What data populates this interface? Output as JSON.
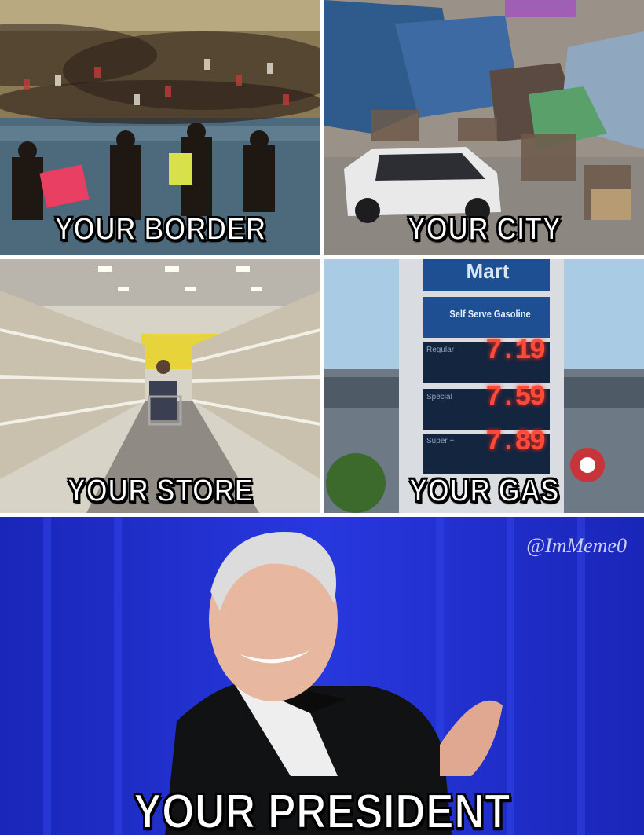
{
  "panels": [
    {
      "id": "border",
      "caption": "YOUR BORDER"
    },
    {
      "id": "city",
      "caption": "YOUR CITY"
    },
    {
      "id": "store",
      "caption": "YOUR STORE"
    },
    {
      "id": "gas",
      "caption": "YOUR GAS"
    },
    {
      "id": "president",
      "caption": "YOUR PRESIDENT"
    }
  ],
  "gas_sign": {
    "brand": "Mart",
    "header": "Self Serve Gasoline",
    "grades": [
      {
        "label": "Regular",
        "price": "7.19"
      },
      {
        "label": "Special",
        "price": "7.59"
      },
      {
        "label": "Super +",
        "price": "7.89"
      }
    ]
  },
  "watermark": "@ImMeme0",
  "colors": {
    "caption_fill": "#ffffff",
    "caption_outline": "#000000",
    "stage_blue": "#1e2fd0",
    "price_red": "#ff4a3a"
  }
}
